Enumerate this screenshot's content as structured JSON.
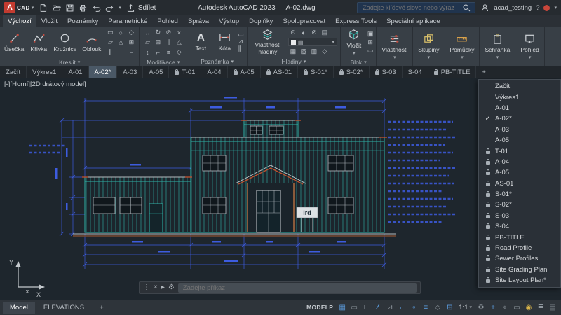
{
  "colors": {
    "teal": "#2fb3a8",
    "dimblue": "#3d5ce0",
    "red": "#c3512f",
    "accent": "#5ea3e8"
  },
  "titlebar": {
    "logo_a": "A",
    "logo_text": "CAD",
    "share_label": "Sdílet",
    "app_title": "Autodesk AutoCAD 2023",
    "doc_title": "A-02.dwg",
    "search_placeholder": "Zadejte klíčové slovo nebo výraz",
    "username": "acad_testing"
  },
  "ribbon": {
    "tabs": [
      {
        "label": "Výchozí",
        "active": true
      },
      {
        "label": "Vložit"
      },
      {
        "label": "Poznámky"
      },
      {
        "label": "Parametrické"
      },
      {
        "label": "Pohled"
      },
      {
        "label": "Správa"
      },
      {
        "label": "Výstup"
      },
      {
        "label": "Doplňky"
      },
      {
        "label": "Spolupracovat"
      },
      {
        "label": "Express Tools"
      },
      {
        "label": "Speciální aplikace"
      }
    ],
    "draw": {
      "label": "Kreslit",
      "tools": [
        "Úsečka",
        "Křivka",
        "Kružnice",
        "Oblouk"
      ],
      "mini": [
        "▭",
        "○",
        "◇",
        "▱",
        "△",
        "⊞",
        "∥",
        "⋯",
        "⌐"
      ]
    },
    "modify": {
      "label": "Modifikace",
      "mini": [
        "↔",
        "↻",
        "⊘",
        "×",
        "▱",
        "⊞",
        "∥",
        "△",
        "↕",
        "⌐",
        "≡",
        "◇"
      ]
    },
    "annotate": {
      "label": "Poznámka",
      "tools": [
        "Text",
        "Kóta"
      ],
      "mini": [
        "▭",
        "⊿",
        "∥"
      ]
    },
    "layers": {
      "label": "Hladiny",
      "button": "Vlastnosti hladiny",
      "mini_top": [
        "⊙",
        "◐",
        "⊘",
        "▤"
      ],
      "mini_bottom": [
        "▦",
        "▧",
        "▥",
        "◇"
      ]
    },
    "block": {
      "label": "Blok",
      "button": "Vložit",
      "mini": [
        "▣",
        "⊞",
        "▭"
      ]
    },
    "collapsed": [
      "Vlastnosti",
      "Skupiny",
      "Pomůcky",
      "Schránka",
      "Pohled"
    ]
  },
  "file_tabs": [
    {
      "label": "Začít"
    },
    {
      "label": "Výkres1"
    },
    {
      "label": "A-01"
    },
    {
      "label": "A-02*",
      "active": true
    },
    {
      "label": "A-03"
    },
    {
      "label": "A-05"
    },
    {
      "label": "T-01",
      "locked": true
    },
    {
      "label": "A-04"
    },
    {
      "label": "A-05",
      "locked": true
    },
    {
      "label": "AS-01",
      "locked": true
    },
    {
      "label": "S-01*",
      "locked": true
    },
    {
      "label": "S-02*",
      "locked": true
    },
    {
      "label": "S-03",
      "locked": true
    },
    {
      "label": "S-04"
    },
    {
      "label": "PB-TITLE",
      "locked": true
    },
    {
      "label": "+"
    }
  ],
  "layout_menu": [
    {
      "label": "Začít"
    },
    {
      "label": "Výkres1"
    },
    {
      "label": "A-01"
    },
    {
      "label": "A-02*",
      "checked": true
    },
    {
      "label": "A-03"
    },
    {
      "label": "A-05"
    },
    {
      "label": "T-01",
      "locked": true
    },
    {
      "label": "A-04",
      "locked": true
    },
    {
      "label": "A-05",
      "locked": true
    },
    {
      "label": "AS-01",
      "locked": true
    },
    {
      "label": "S-01*",
      "locked": true
    },
    {
      "label": "S-02*",
      "locked": true
    },
    {
      "label": "S-03",
      "locked": true
    },
    {
      "label": "S-04",
      "locked": true
    },
    {
      "label": "PB-TITLE",
      "locked": true
    },
    {
      "label": "Road Profile",
      "locked": true
    },
    {
      "label": "Sewer Profiles",
      "locked": true
    },
    {
      "label": "Site Grading Plan",
      "locked": true
    },
    {
      "label": "Site Layout Plan*",
      "locked": true
    }
  ],
  "canvas": {
    "viewport_label": "[-][Horní][2D drátový model]",
    "sign_text": "ird",
    "ucs_x": "X",
    "ucs_y": "Y"
  },
  "command_line": {
    "placeholder": "Zadejte příkaz"
  },
  "statusbar": {
    "model_tab": "Model",
    "layout_tab": "ELEVATIONS",
    "new_layout_label": "+",
    "space_label": "MODELP",
    "scale": "1:1",
    "icons": [
      {
        "name": "grid-icon",
        "glyph": "▦",
        "active": true
      },
      {
        "name": "snap-mode-icon",
        "glyph": "▭"
      },
      {
        "name": "ortho-icon",
        "glyph": "∟"
      },
      {
        "name": "polar-tracking-icon",
        "glyph": "∠",
        "active": true
      },
      {
        "name": "isodraft-icon",
        "glyph": "⊿"
      },
      {
        "name": "object-snap-tracking-icon",
        "glyph": "⌐",
        "active": true
      },
      {
        "name": "object-snap-icon",
        "glyph": "⌖",
        "active": true
      },
      {
        "name": "lineweight-icon",
        "glyph": "≡",
        "active": true
      },
      {
        "name": "transparency-icon",
        "glyph": "◇"
      },
      {
        "name": "dynamic-input-icon",
        "glyph": "⊞",
        "active": true
      }
    ],
    "right_icons": [
      {
        "name": "workspace-gear-icon",
        "glyph": "⚙"
      },
      {
        "name": "annotation-monitor-icon",
        "glyph": "+",
        "active": true
      },
      {
        "name": "crosshair-icon",
        "glyph": "⌖"
      },
      {
        "name": "graphics-performance-icon",
        "glyph": "▭"
      },
      {
        "name": "isolate-objects-icon",
        "glyph": "◉",
        "color": "#d9b44a"
      },
      {
        "name": "customization-icon",
        "glyph": "≣"
      },
      {
        "name": "clean-screen-icon",
        "glyph": "▤"
      }
    ]
  }
}
